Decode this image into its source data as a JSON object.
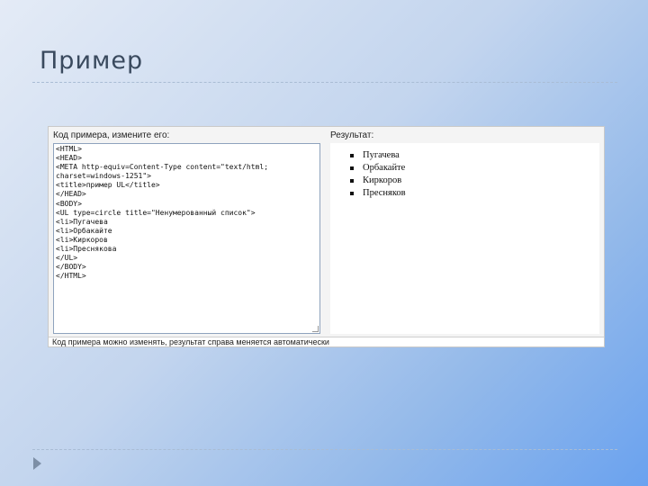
{
  "slide": {
    "title": "Пример"
  },
  "demo": {
    "left_header": "Код примера, измените его:",
    "right_header": "Результат:",
    "code_lines": [
      "<HTML>",
      "<HEAD>",
      "<META http-equiv=Content-Type content=\"text/html;",
      "charset=windows-1251\">",
      "<title>пример UL</title>",
      "</HEAD>",
      "<BODY>",
      "<UL type=circle title=\"Ненумерованный список\">",
      "<li>Пугачева",
      "<li>Орбакайте",
      "<li>Киркоров",
      "<li>Преснякова",
      "</UL>",
      "</BODY>",
      "</HTML>"
    ],
    "result_items": [
      "Пугачева",
      "Орбакайте",
      "Киркоров",
      "Пресняков"
    ],
    "footer": "Код примера можно изменять, результат справа меняется автоматически"
  },
  "icons": {
    "nav": "triangle-right-icon"
  }
}
